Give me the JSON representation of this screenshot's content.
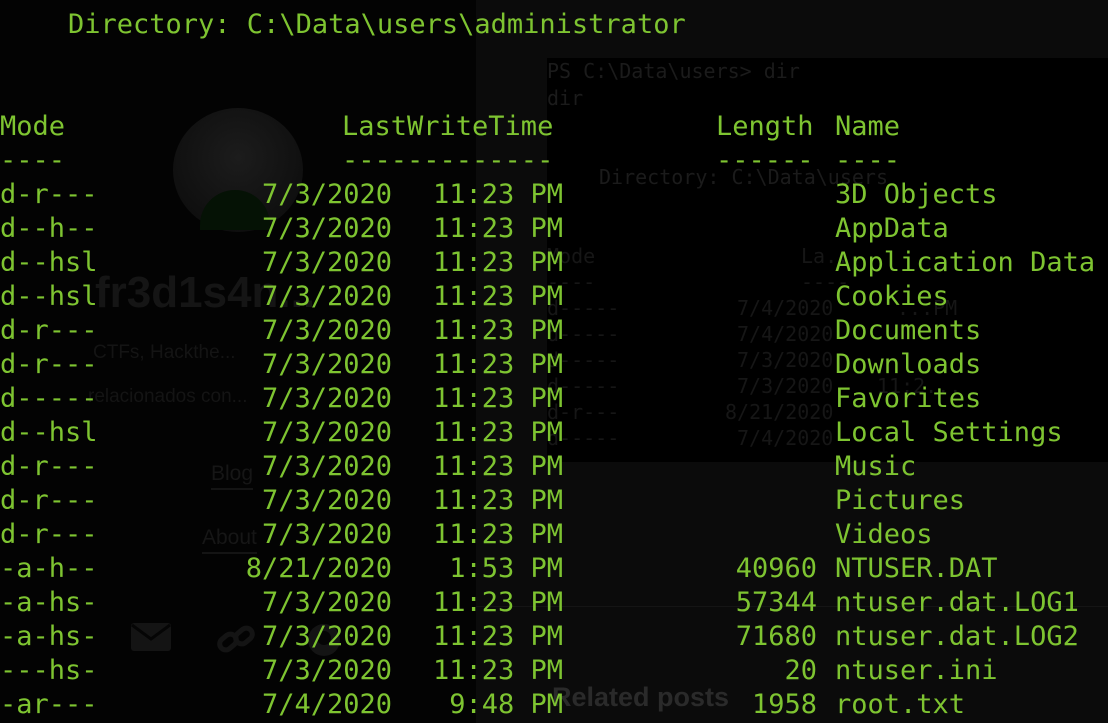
{
  "terminal": {
    "directory_line": "Directory: C:\\Data\\users\\administrator",
    "headers": {
      "mode": "Mode",
      "lastwritetime": "LastWriteTime",
      "length": "Length",
      "name": "Name"
    },
    "separators": {
      "mode": "----",
      "lastwritetime": "-------------",
      "length": "------",
      "name": "----"
    },
    "rows": [
      {
        "mode": "d-r---",
        "date": "7/3/2020",
        "time": "11:23 PM",
        "length": "",
        "name": "3D Objects"
      },
      {
        "mode": "d--h--",
        "date": "7/3/2020",
        "time": "11:23 PM",
        "length": "",
        "name": "AppData"
      },
      {
        "mode": "d--hsl",
        "date": "7/3/2020",
        "time": "11:23 PM",
        "length": "",
        "name": "Application Data"
      },
      {
        "mode": "d--hsl",
        "date": "7/3/2020",
        "time": "11:23 PM",
        "length": "",
        "name": "Cookies"
      },
      {
        "mode": "d-r---",
        "date": "7/3/2020",
        "time": "11:23 PM",
        "length": "",
        "name": "Documents"
      },
      {
        "mode": "d-r---",
        "date": "7/3/2020",
        "time": "11:23 PM",
        "length": "",
        "name": "Downloads"
      },
      {
        "mode": "d-----",
        "date": "7/3/2020",
        "time": "11:23 PM",
        "length": "",
        "name": "Favorites"
      },
      {
        "mode": "d--hsl",
        "date": "7/3/2020",
        "time": "11:23 PM",
        "length": "",
        "name": "Local Settings"
      },
      {
        "mode": "d-r---",
        "date": "7/3/2020",
        "time": "11:23 PM",
        "length": "",
        "name": "Music"
      },
      {
        "mode": "d-r---",
        "date": "7/3/2020",
        "time": "11:23 PM",
        "length": "",
        "name": "Pictures"
      },
      {
        "mode": "d-r---",
        "date": "7/3/2020",
        "time": "11:23 PM",
        "length": "",
        "name": "Videos"
      },
      {
        "mode": "-a-h--",
        "date": "8/21/2020",
        "time": "1:53 PM",
        "length": "40960",
        "name": "NTUSER.DAT"
      },
      {
        "mode": "-a-hs-",
        "date": "7/3/2020",
        "time": "11:23 PM",
        "length": "57344",
        "name": "ntuser.dat.LOG1"
      },
      {
        "mode": "-a-hs-",
        "date": "7/3/2020",
        "time": "11:23 PM",
        "length": "71680",
        "name": "ntuser.dat.LOG2"
      },
      {
        "mode": "---hs-",
        "date": "7/3/2020",
        "time": "11:23 PM",
        "length": "20",
        "name": "ntuser.ini"
      },
      {
        "mode": "-ar---",
        "date": "7/4/2020",
        "time": "9:48 PM",
        "length": "1958",
        "name": "root.txt"
      }
    ]
  },
  "background_blog": {
    "title": "fr3d1s4n...",
    "subtitle_1": "CTFs, Hackthe...",
    "subtitle_2": "relacionados con...",
    "nav_blog": "Blog",
    "nav_about": "About",
    "related_posts": "Related posts"
  },
  "background_console": {
    "prompt": "PS C:\\Data\\users> dir",
    "echo": "dir",
    "directory_line": "Directory: C:\\Data\\users",
    "mode_header": "Mode",
    "lwt_header": "La...",
    "sep_mode": "----",
    "sep_lwt": "----",
    "rows": [
      {
        "mode": "d-----",
        "date": "7/4/2020",
        "time": "...PM"
      },
      {
        "mode": "d-----",
        "date": "7/4/2020",
        "time": ""
      },
      {
        "mode": "d-----",
        "date": "7/3/2020",
        "time": ""
      },
      {
        "mode": "d-----",
        "date": "7/3/2020",
        "time": "11:2..."
      },
      {
        "mode": "d-r---",
        "date": "8/21/2020",
        "time": ""
      },
      {
        "mode": "d-----",
        "date": "7/4/2020",
        "time": ""
      }
    ]
  },
  "colors": {
    "terminal_green": "#7ec431",
    "background": "#000000"
  }
}
